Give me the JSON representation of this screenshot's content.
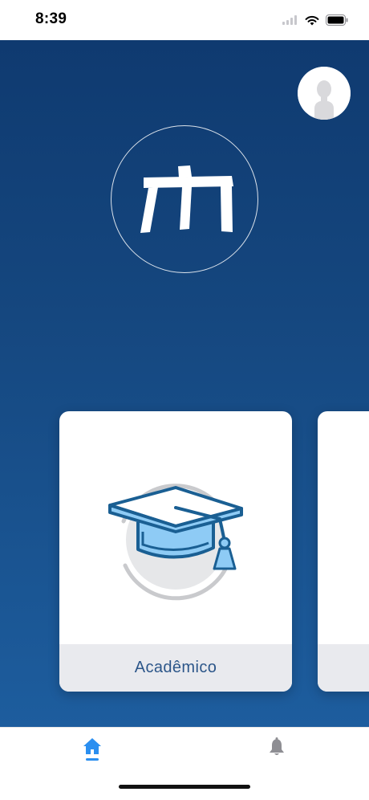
{
  "status_bar": {
    "time": "8:39",
    "icons": [
      "cellular-icon",
      "wifi-icon",
      "battery-icon"
    ]
  },
  "header": {
    "avatar_icon": "user-avatar-icon",
    "logo_icon": "brand-logo-icon"
  },
  "cards": [
    {
      "label": "Acadêmico",
      "icon": "graduation-cap-icon"
    },
    {
      "label": "",
      "icon": ""
    }
  ],
  "tab_bar": {
    "items": [
      {
        "icon": "home-icon",
        "active": true
      },
      {
        "icon": "bell-icon",
        "active": false
      }
    ]
  },
  "colors": {
    "background_top": "#0f3a70",
    "background_bottom": "#1d5d9e",
    "card_footer": "#e9eaee",
    "card_label": "#2c5689",
    "active_tab": "#2b8ff0",
    "inactive_tab": "#8e8e93",
    "cap_outline": "#1a5f93",
    "cap_fill": "#8ecbf5"
  }
}
